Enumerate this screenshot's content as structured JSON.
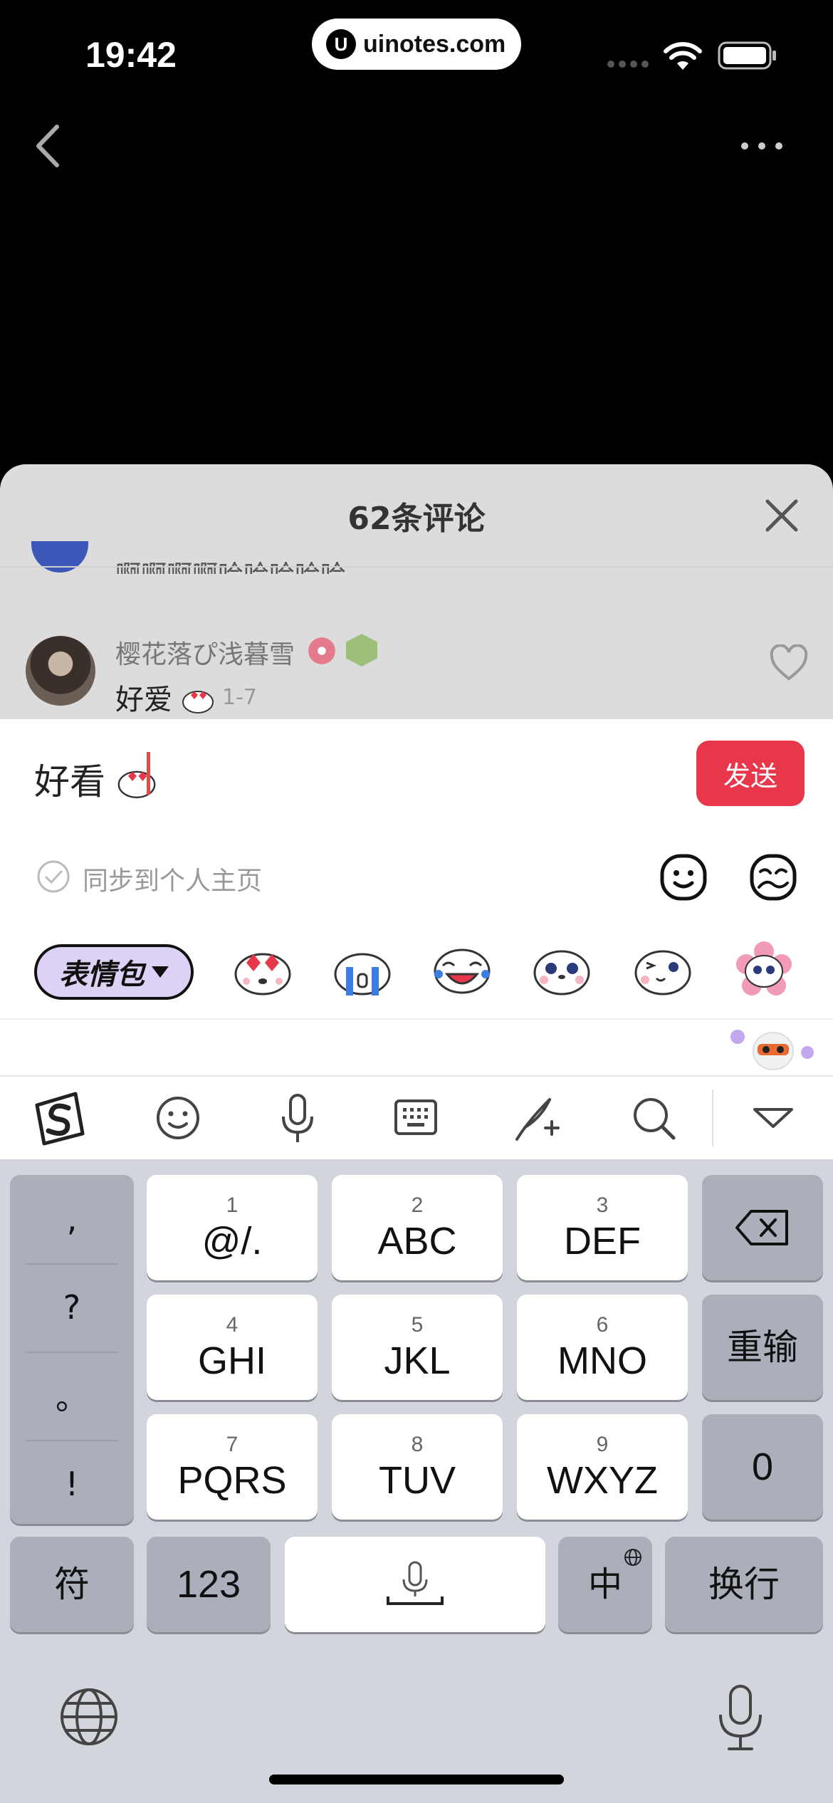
{
  "status_bar": {
    "time": "19:42",
    "url": "uinotes.com",
    "logo": "U"
  },
  "sheet": {
    "title": "62条评论"
  },
  "previous_comment": {
    "text": "啊啊啊啊哈哈哈哈哈"
  },
  "comment": {
    "username": "樱花落ぴ浅暮雪",
    "text": "好爱",
    "date": "1-7"
  },
  "input": {
    "value": "好看",
    "send_label": "发送",
    "sync_label": "同步到个人主页"
  },
  "stickers": {
    "tab_label": "表情包",
    "items": [
      "heart-eyes-seal-icon",
      "crying-seal-icon",
      "laughing-seal-icon",
      "blushing-seal-icon",
      "winking-seal-icon",
      "flower-seal-icon"
    ]
  },
  "ime_toolbar": {
    "icons": [
      "sogou-logo-icon",
      "emoji-icon",
      "microphone-icon",
      "keyboard-icon",
      "handwriting-icon",
      "search-icon",
      "collapse-icon"
    ]
  },
  "keyboard": {
    "punctuation": [
      ",",
      "?",
      "。",
      "!"
    ],
    "keys": [
      {
        "num": "1",
        "label": "@/."
      },
      {
        "num": "2",
        "label": "ABC"
      },
      {
        "num": "3",
        "label": "DEF"
      },
      {
        "num": "4",
        "label": "GHI"
      },
      {
        "num": "5",
        "label": "JKL"
      },
      {
        "num": "6",
        "label": "MNO"
      },
      {
        "num": "7",
        "label": "PQRS"
      },
      {
        "num": "8",
        "label": "TUV"
      },
      {
        "num": "9",
        "label": "WXYZ"
      }
    ],
    "reenter": "重输",
    "zero": "0",
    "symbol": "符",
    "numeric": "123",
    "chinese": "中",
    "return": "换行"
  },
  "colors": {
    "accent": "#e8364a",
    "sticker_tab": "#ddd2f5",
    "keyboard_bg": "#d3d5dc"
  }
}
